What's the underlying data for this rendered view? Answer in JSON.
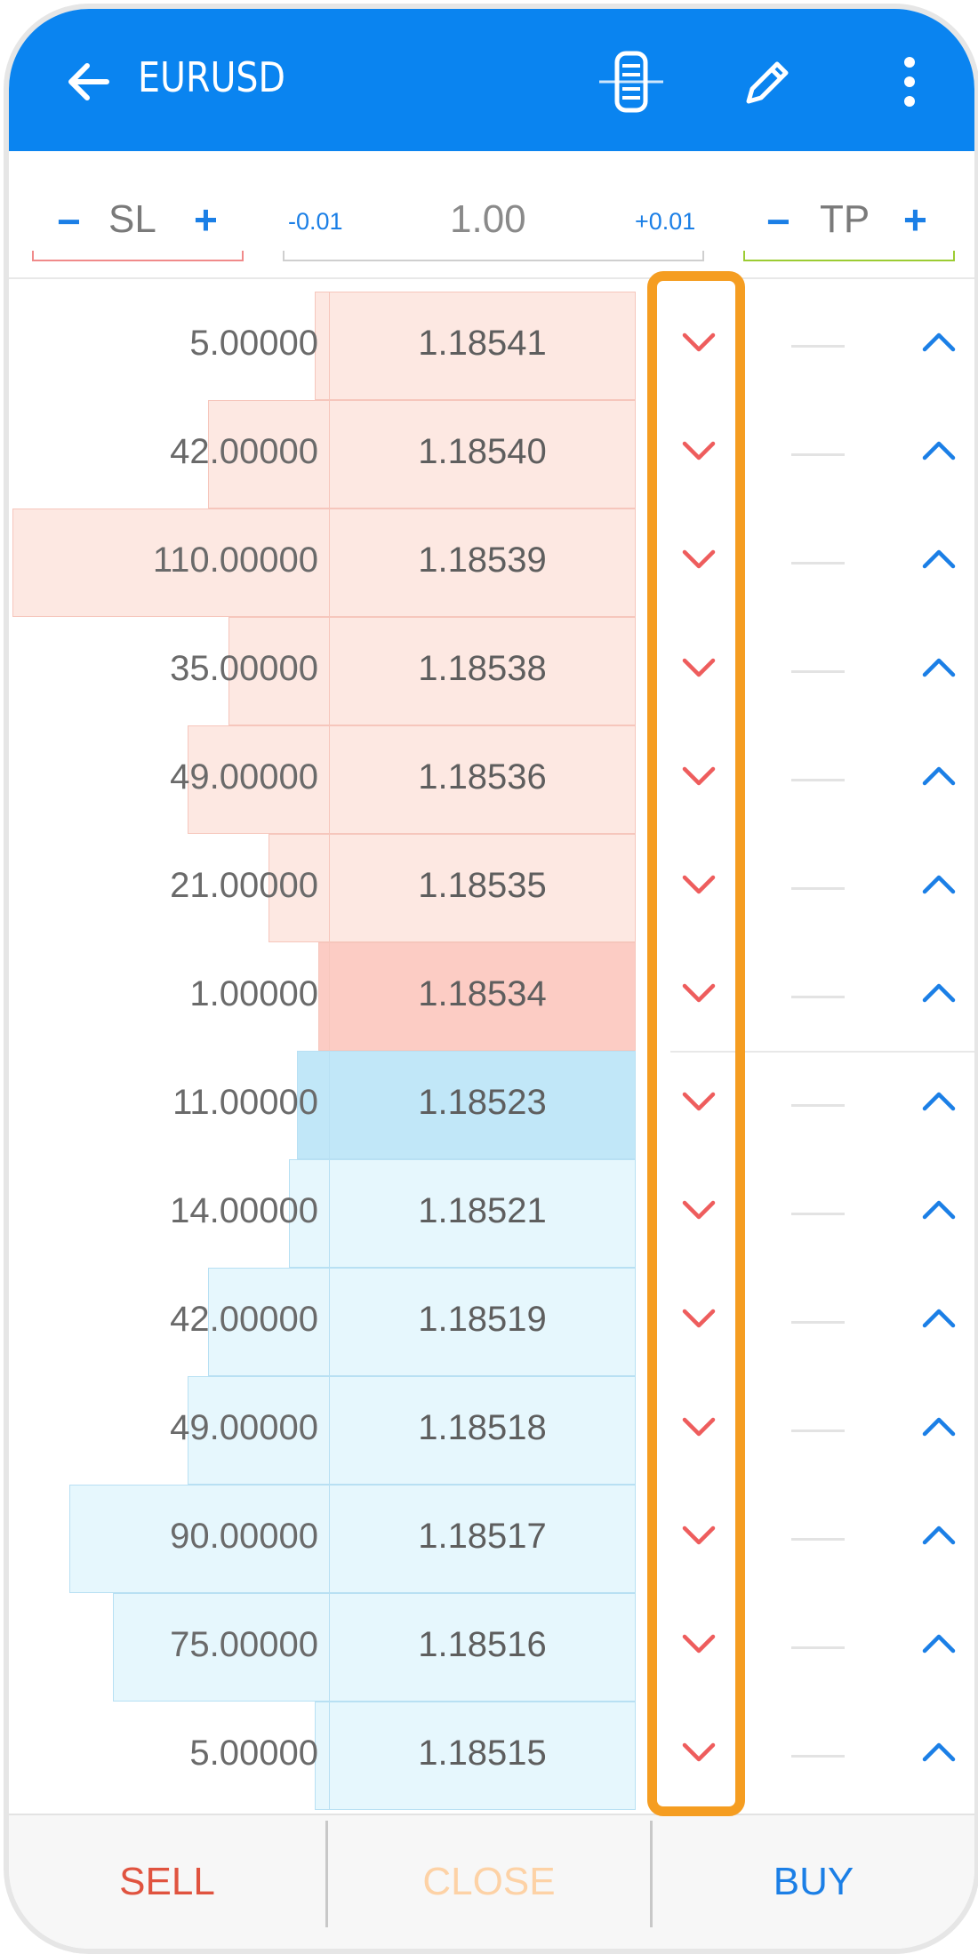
{
  "header": {
    "title": "EURUSD",
    "icons": [
      "back-arrow-icon",
      "depth-of-market-icon",
      "pencil-icon",
      "more-vert-icon"
    ]
  },
  "controls": {
    "sl_label": "SL",
    "tp_label": "TP",
    "minus": "−",
    "plus": "+",
    "volume_value": "1.00",
    "volume_decrement": "-0.01",
    "volume_increment": "+0.01"
  },
  "book": {
    "sell_color": "#f8d4cc",
    "buy_color": "#dcf1fb",
    "asks": [
      {
        "volume": "5.00000",
        "price": "1.18541",
        "vol_num": 5
      },
      {
        "volume": "42.00000",
        "price": "1.18540",
        "vol_num": 42
      },
      {
        "volume": "110.00000",
        "price": "1.18539",
        "vol_num": 110
      },
      {
        "volume": "35.00000",
        "price": "1.18538",
        "vol_num": 35
      },
      {
        "volume": "49.00000",
        "price": "1.18536",
        "vol_num": 49
      },
      {
        "volume": "21.00000",
        "price": "1.18535",
        "vol_num": 21
      },
      {
        "volume": "1.00000",
        "price": "1.18534",
        "vol_num": 1,
        "best": true
      }
    ],
    "bids": [
      {
        "volume": "11.00000",
        "price": "1.18523",
        "vol_num": 11,
        "best": true
      },
      {
        "volume": "14.00000",
        "price": "1.18521",
        "vol_num": 14
      },
      {
        "volume": "42.00000",
        "price": "1.18519",
        "vol_num": 42
      },
      {
        "volume": "49.00000",
        "price": "1.18518",
        "vol_num": 49
      },
      {
        "volume": "90.00000",
        "price": "1.18517",
        "vol_num": 90
      },
      {
        "volume": "75.00000",
        "price": "1.18516",
        "vol_num": 75
      },
      {
        "volume": "5.00000",
        "price": "1.18515",
        "vol_num": 5
      }
    ]
  },
  "footer": {
    "sell_label": "SELL",
    "close_label": "CLOSE",
    "buy_label": "BUY",
    "sell_color": "#e0533f",
    "close_color": "#fdd2a6",
    "buy_color": "#1b7fe6"
  }
}
